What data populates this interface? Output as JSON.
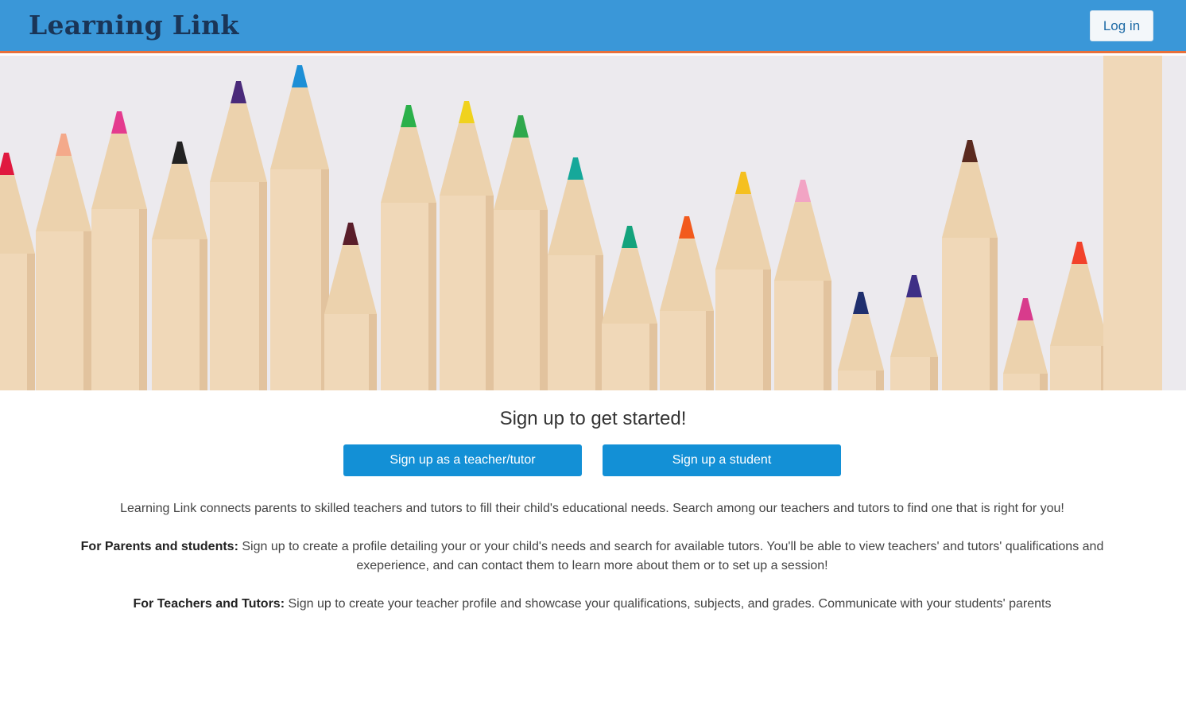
{
  "header": {
    "brand": "Learning Link",
    "login_label": "Log in",
    "bg_color": "#3a97d8",
    "accent_border_color": "#e8703a"
  },
  "hero": {
    "pencil_tip_colors": [
      "#e0193f",
      "#f4a98a",
      "#e43b8e",
      "#222222",
      "#4a2a7a",
      "#1d8fd6",
      "#5a1e2a",
      "#2bb04a",
      "#f0d21e",
      "#2fa84c",
      "#16a89a",
      "#14a37c",
      "#f25a1d",
      "#f5c020",
      "#f2a4c4",
      "#1f2f6e",
      "#3e2f86",
      "#5a2a1f",
      "#d83b8c",
      "#f2422b"
    ]
  },
  "signup": {
    "title": "Sign up to get started!",
    "teacher_button": "Sign up as a teacher/tutor",
    "student_button": "Sign up a student"
  },
  "info": {
    "intro": "Learning Link connects parents to skilled teachers and tutors to fill their child's educational needs. Search among our teachers and tutors to find one that is right for you!",
    "parents_heading": "For Parents and students:",
    "parents_text": " Sign up to create a profile detailing your or your child's needs and search for available tutors. You'll be able to view teachers' and tutors' qualifications and exeperience, and can contact them to learn more about them or to set up a session!",
    "teachers_heading": "For Teachers and Tutors:",
    "teachers_text": " Sign up to create your teacher profile and showcase your qualifications, subjects, and grades. Communicate with your students' parents"
  }
}
